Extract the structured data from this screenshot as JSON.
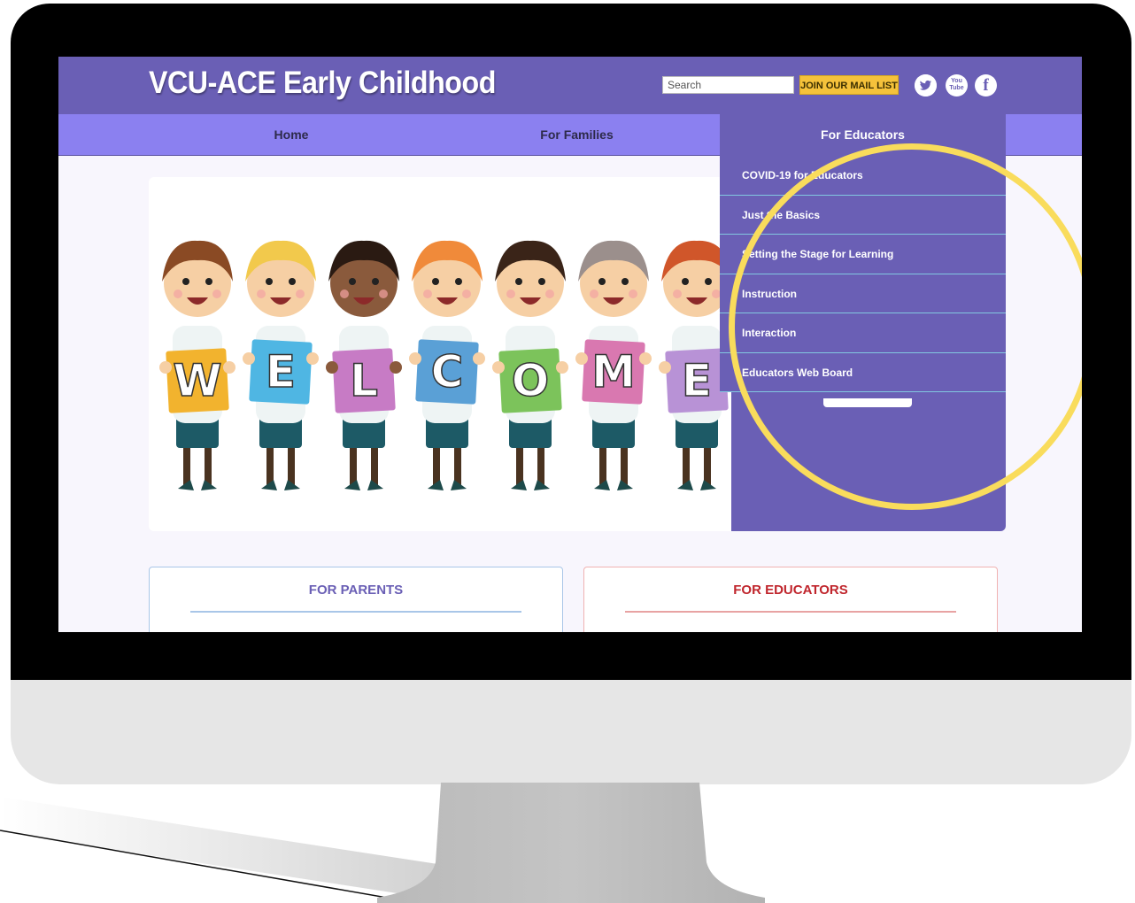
{
  "site": {
    "title": "VCU-ACE Early Childhood",
    "search_placeholder": "Search",
    "mail_list_label": "JOIN OUR MAIL LIST",
    "social_icons": [
      "twitter-icon",
      "youtube-icon",
      "facebook-icon"
    ],
    "youtube_glyph": "You\nTube",
    "facebook_glyph": "f"
  },
  "nav": {
    "items": [
      {
        "label": "Home"
      },
      {
        "label": "For Families"
      },
      {
        "label": "For Educators",
        "active": true
      }
    ]
  },
  "dropdown": {
    "items": [
      {
        "label": "COVID-19 for Educators"
      },
      {
        "label": "Just the Basics"
      },
      {
        "label": "Setting the Stage for Learning"
      },
      {
        "label": "Instruction"
      },
      {
        "label": "Interaction"
      },
      {
        "label": "Educators Web Board"
      }
    ]
  },
  "hero": {
    "banner_letters": [
      "W",
      "E",
      "L",
      "C",
      "O",
      "M",
      "E"
    ],
    "letter_colors": [
      "#f2b32e",
      "#4fb6e3",
      "#c77bc5",
      "#5aa0d6",
      "#7cc35b",
      "#d978b0",
      "#b892d6"
    ]
  },
  "cards": {
    "parents_title": "FOR PARENTS",
    "educators_title": "FOR EDUCATORS"
  },
  "colors": {
    "header": "#6a5fb5",
    "navbar": "#8b80f0",
    "highlight": "#f9dc5c",
    "mail_button": "#f5c23b"
  }
}
